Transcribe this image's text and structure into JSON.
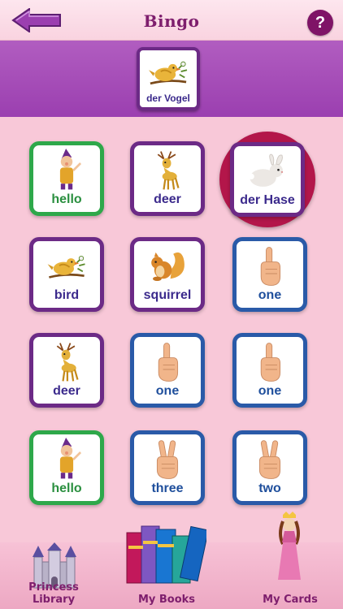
{
  "header": {
    "title": "Bingo",
    "help_label": "?"
  },
  "caller": {
    "label": "der Vogel",
    "icon": "bird"
  },
  "grid": [
    {
      "label": "hello",
      "icon": "gnome",
      "color": "green"
    },
    {
      "label": "deer",
      "icon": "deer",
      "color": "purple"
    },
    {
      "label": "der Hase",
      "icon": "rabbit",
      "color": "purple",
      "selected": true
    },
    {
      "label": "bird",
      "icon": "bird",
      "color": "purple"
    },
    {
      "label": "squirrel",
      "icon": "squirrel",
      "color": "purple"
    },
    {
      "label": "one",
      "icon": "hand-one",
      "color": "blue"
    },
    {
      "label": "deer",
      "icon": "deer",
      "color": "purple"
    },
    {
      "label": "one",
      "icon": "hand-one",
      "color": "blue"
    },
    {
      "label": "one",
      "icon": "hand-one",
      "color": "blue"
    },
    {
      "label": "hello",
      "icon": "gnome",
      "color": "green"
    },
    {
      "label": "three",
      "icon": "hand-two",
      "color": "blue"
    },
    {
      "label": "two",
      "icon": "hand-two",
      "color": "blue"
    }
  ],
  "nav": [
    {
      "label": "Princess Library",
      "icon": "castle"
    },
    {
      "label": "My Books",
      "icon": "books"
    },
    {
      "label": "My Cards",
      "icon": "princess"
    }
  ],
  "colors": {
    "header_title": "#7e1e6d",
    "band": "#a94bbb",
    "green": "#2ea84a",
    "purple": "#6c2a86",
    "blue": "#2a5aa8",
    "selected_ring": "#b3164a",
    "background": "#f8c8d8"
  }
}
